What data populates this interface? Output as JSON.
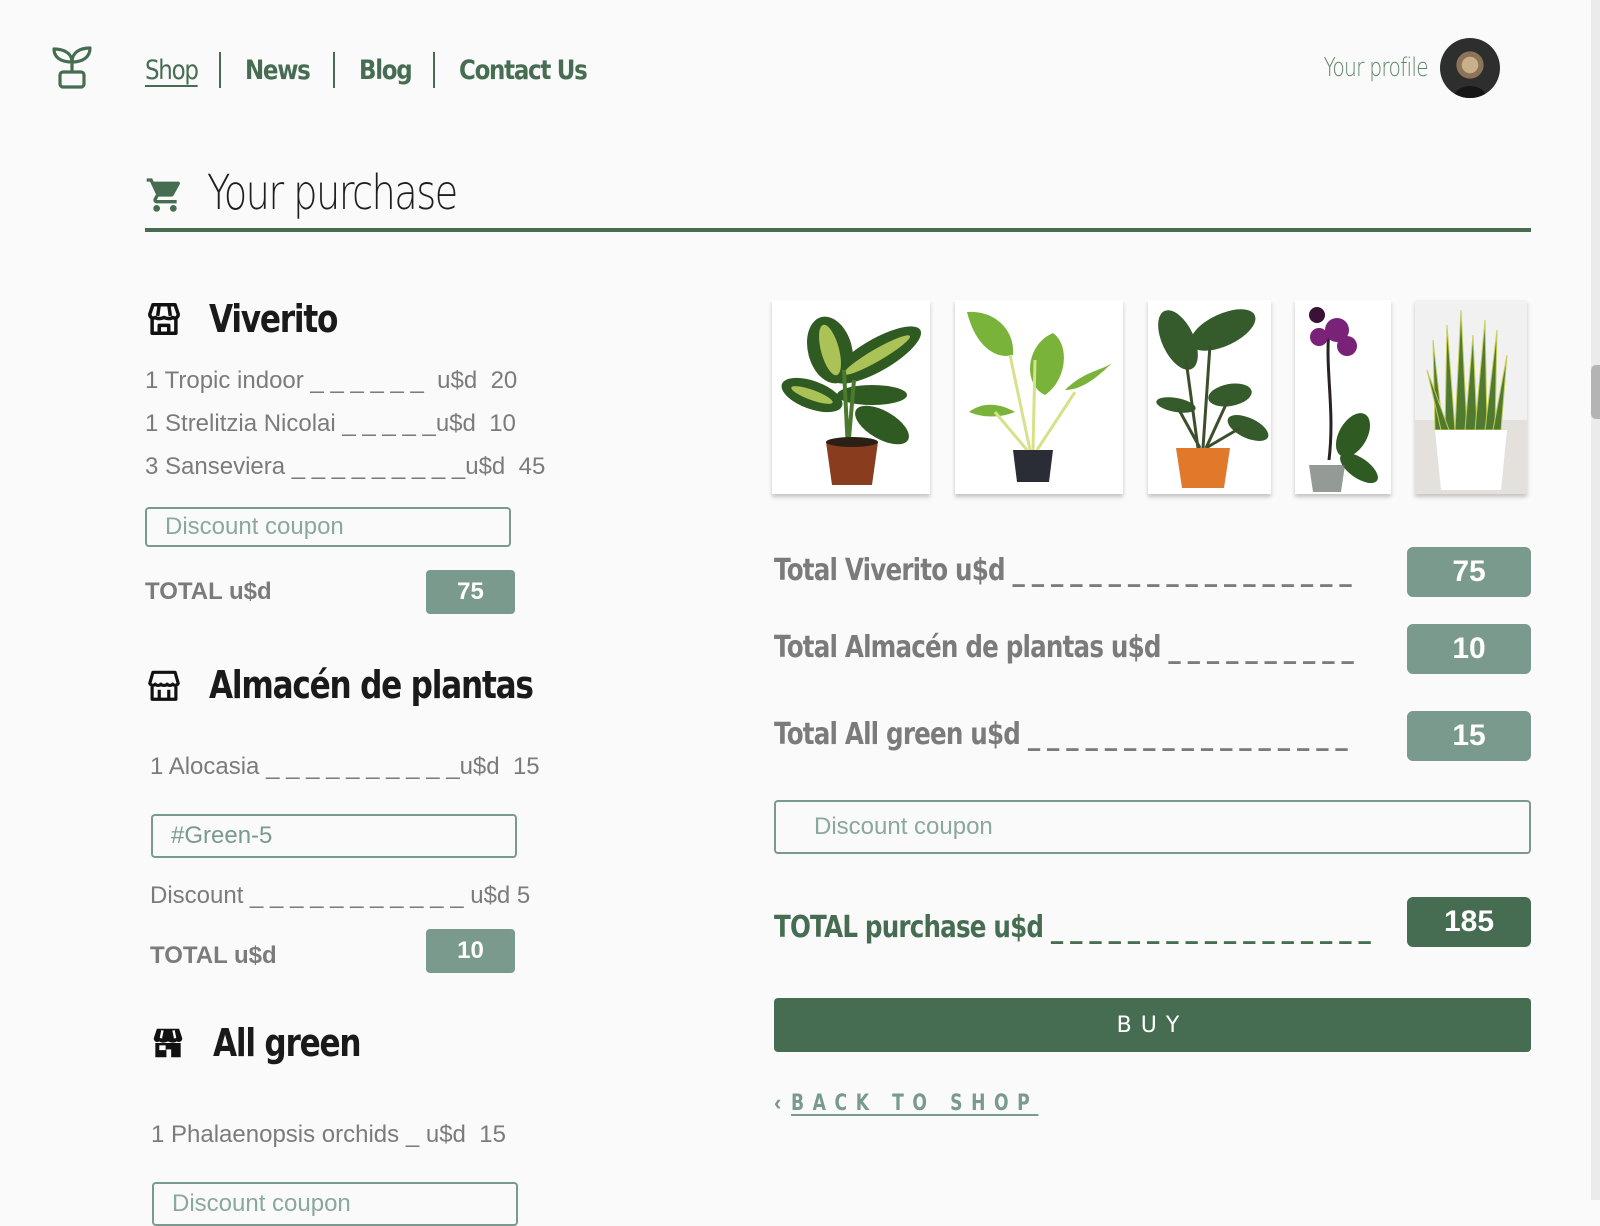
{
  "header": {
    "nav": [
      {
        "label": "Shop",
        "current": true
      },
      {
        "label": "News"
      },
      {
        "label": "Blog"
      },
      {
        "label": "Contact Us"
      }
    ],
    "profile_label": "Your profile"
  },
  "page": {
    "title": "Your purchase"
  },
  "stores": [
    {
      "name": "Viverito",
      "items": [
        "1 Tropic indoor _ _ _ _ _ _  u$d  20",
        "1 Strelitzia Nicolai _ _ _ _ _u$d  10",
        "3 Sanseviera _ _ _ _ _ _ _ _ _u$d  45"
      ],
      "coupon": {
        "value": "",
        "placeholder": "Discount coupon"
      },
      "total_label": "TOTAL u$d",
      "total": "75"
    },
    {
      "name": "Almacén de plantas",
      "items": [
        "1 Alocasia _ _ _ _ _ _ _ _ _ _u$d  15"
      ],
      "coupon": {
        "value": "#Green-5",
        "placeholder": "Discount coupon"
      },
      "discount_line": "Discount _ _ _ _ _ _ _ _ _ _ _ u$d 5",
      "total_label": "TOTAL u$d",
      "total": "10"
    },
    {
      "name": "All green",
      "items": [
        "1 Phalaenopsis orchids _ u$d  15"
      ],
      "coupon": {
        "value": "",
        "placeholder": "Discount coupon"
      }
    }
  ],
  "photos": [
    {
      "alt": "Dieffenbachia in brown pot"
    },
    {
      "alt": "Alocasia in black pot"
    },
    {
      "alt": "Strelitzia in orange pot"
    },
    {
      "alt": "Purple phalaenopsis orchid"
    },
    {
      "alt": "Sanseviera in white pot"
    }
  ],
  "summary": {
    "rows": [
      {
        "label": "Total Viverito u$d _ _ _ _ _ _ _ _ _ _ _ _ _ _ _ _ _ _",
        "value": "75"
      },
      {
        "label": "Total Almacén de plantas u$d _ _ _ _ _ _ _ _ _ _",
        "value": "10"
      },
      {
        "label": "Total All green u$d _ _ _ _ _ _ _ _ _ _ _ _ _ _ _ _ _",
        "value": "15"
      }
    ],
    "coupon": {
      "value": "",
      "placeholder": "Discount coupon"
    },
    "grand_total_label": "TOTAL purchase u$d _ _ _ _ _ _ _ _ _ _ _ _ _ _ _ _ _",
    "grand_total": "185",
    "buy_label": "BUY",
    "back_label": "BACK TO SHOP"
  },
  "colors": {
    "brand": "#466d52",
    "muted": "#7a9a8e",
    "text": "#7b7b7b",
    "background": "#fafafa"
  }
}
